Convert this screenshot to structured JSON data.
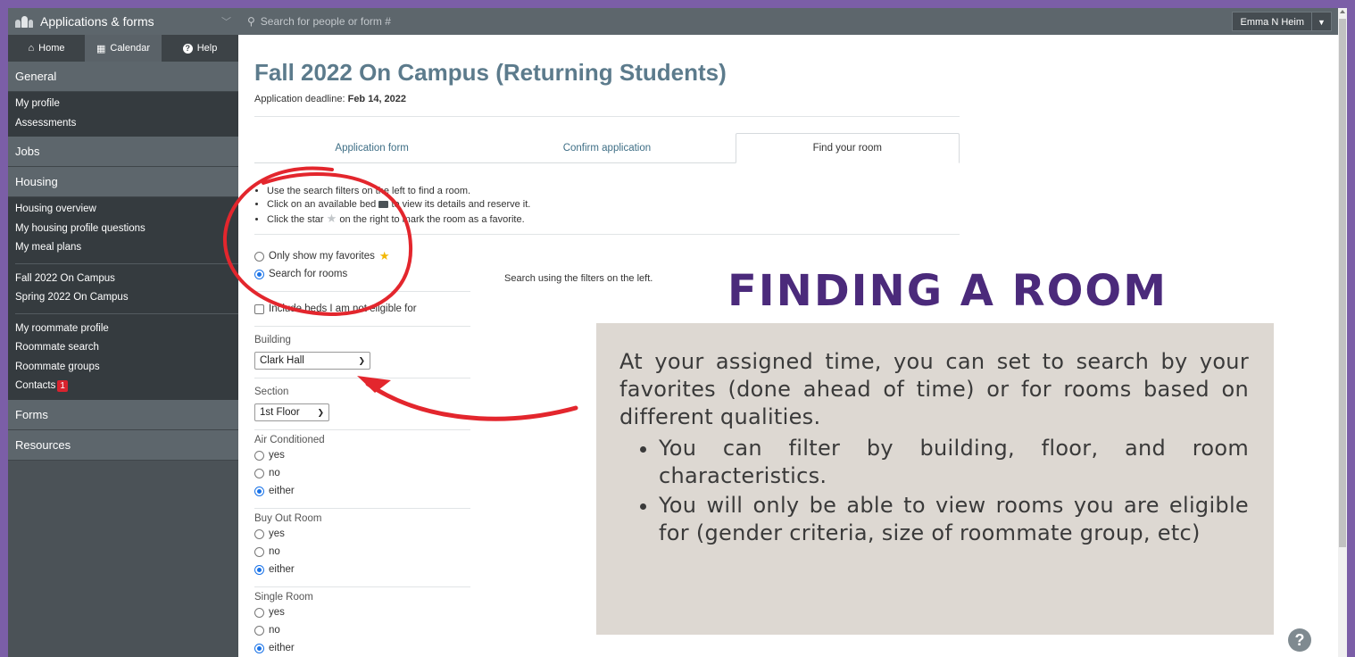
{
  "sidebar": {
    "app_title": "Applications & forms",
    "tabs": [
      {
        "label": "Home"
      },
      {
        "label": "Calendar"
      },
      {
        "label": "Help"
      }
    ],
    "general": {
      "label": "General",
      "items": [
        "My profile",
        "Assessments"
      ]
    },
    "jobs": {
      "label": "Jobs"
    },
    "housing": {
      "label": "Housing",
      "items": [
        "Housing overview",
        "My housing profile questions",
        "My meal plans"
      ],
      "items2": [
        "Fall 2022 On Campus",
        "Spring 2022 On Campus"
      ],
      "items3": [
        "My roommate profile",
        "Roommate search",
        "Roommate groups"
      ],
      "contacts": {
        "label": "Contacts",
        "count": "1"
      }
    },
    "forms": {
      "label": "Forms"
    },
    "resources": {
      "label": "Resources"
    }
  },
  "topbar": {
    "search_placeholder": "Search for people or form #",
    "user_name": "Emma N Heim"
  },
  "main": {
    "title": "Fall 2022 On Campus (Returning Students)",
    "deadline_label": "Application deadline:",
    "deadline_value": "Feb 14, 2022",
    "tabs": [
      {
        "label": "Application form"
      },
      {
        "label": "Confirm application"
      },
      {
        "label": "Find your room"
      }
    ],
    "instructions": [
      "Use the search filters on the left to find a room.",
      "Click on an available bed",
      "to view its details and reserve it.",
      "Click the star",
      "on the right to mark the room as a favorite."
    ],
    "mode": {
      "favorites": "Only show my favorites",
      "search": "Search for rooms"
    },
    "include_ineligible": "Include beds I am not eligible for",
    "building": {
      "label": "Building",
      "value": "Clark Hall"
    },
    "section": {
      "label": "Section",
      "value": "1st Floor"
    },
    "air_conditioned": {
      "label": "Air Conditioned",
      "options": [
        "yes",
        "no",
        "either"
      ]
    },
    "buy_out": {
      "label": "Buy Out Room",
      "options": [
        "yes",
        "no",
        "either"
      ]
    },
    "single_room": {
      "label": "Single Room",
      "options": [
        "yes",
        "no",
        "either"
      ]
    },
    "hint": "Search using the filters on the left."
  },
  "callout": {
    "title": "FINDING A ROOM",
    "intro": "At your assigned time, you can set to search by your favorites (done ahead of time) or for rooms based on different qualities.",
    "bullets": [
      "You can filter by building, floor, and room characteristics.",
      "You will only be able to view rooms you are eligible for (gender criteria, size of roommate group, etc)"
    ]
  },
  "colors": {
    "frame": "#7b5ea7",
    "sidebar": "#4b5257",
    "title": "#5c7b8c",
    "callout_title": "#4b2a7b",
    "callout_bg": "#ddd8d2",
    "annotation_red": "#e3262d"
  }
}
